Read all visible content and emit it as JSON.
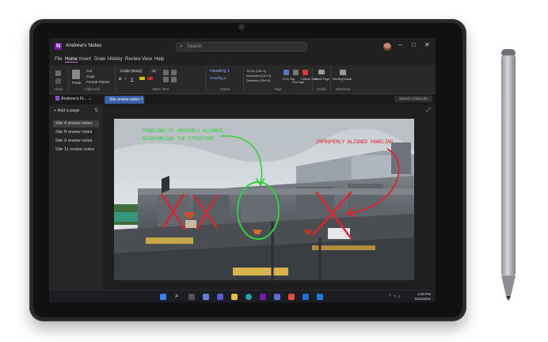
{
  "app": {
    "title": "Andrew's Notes",
    "search_placeholder": "Search"
  },
  "window_controls": [
    "–",
    "□",
    "✕"
  ],
  "menu": [
    "File",
    "Home",
    "Insert",
    "Draw",
    "History",
    "Review",
    "View",
    "Help"
  ],
  "ribbon": {
    "groups": [
      "Undo",
      "Clipboard",
      "Basic Text",
      "Styles",
      "Tags",
      "Email",
      "Meetings"
    ],
    "clipboard": {
      "paste": "Paste",
      "cut": "Cut",
      "copy": "Copy",
      "format_painter": "Format Painter"
    },
    "font": {
      "family": "Calibri (Body)",
      "size": "11"
    },
    "styles": {
      "heading1": "Heading 1",
      "heading2": "Heading 2"
    },
    "tags": [
      "To Do (Ctrl+1)",
      "Important (Ctrl+2)",
      "Question (Ctrl+3)"
    ],
    "actions": [
      "To Do Tag",
      "Find Tags",
      "Outlook Tasks",
      "Email Page",
      "Meeting Details"
    ]
  },
  "notebook": {
    "name": "Andrew's N...",
    "section_tab": "Site review notes",
    "search_notebooks": "Search notebooks"
  },
  "sidebar": {
    "add_page": "Add a page",
    "pages": [
      "Site 4 review notes",
      "Site 8 review notes",
      "Site 9 review notes",
      "Site 11 review notes"
    ]
  },
  "annotations": {
    "green": "PANELING IS PROPERLY ALIGNED, REINFORCING THE STRUCTURE",
    "red": "IMPROPERLY ALIGNED PANELING"
  },
  "taskbar": {
    "time": "2:30 PM",
    "date": "6/23/2022"
  },
  "colors": {
    "accent": "#7719aa",
    "ink_green": "#2fd13c",
    "ink_red": "#e3222b",
    "section_tab": "#3b5ea8"
  }
}
